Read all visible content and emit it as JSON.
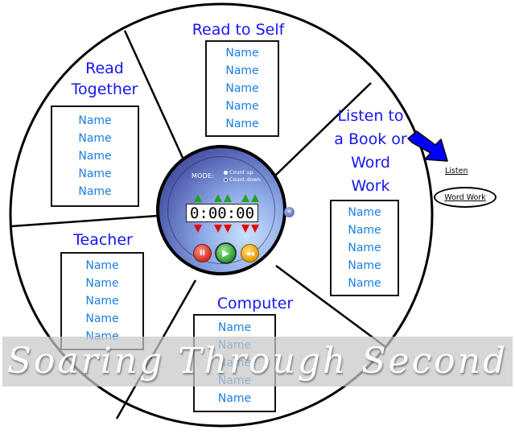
{
  "stations": {
    "read_to_self": {
      "title": "Read to Self",
      "names": [
        "Name",
        "Name",
        "Name",
        "Name",
        "Name"
      ]
    },
    "read_together": {
      "title_line1": "Read",
      "title_line2": "Together",
      "names": [
        "Name",
        "Name",
        "Name",
        "Name",
        "Name"
      ]
    },
    "listen_word_work": {
      "title_line1": "Listen to",
      "title_line2": "a Book or",
      "title_line3": "Word",
      "title_line4": "Work",
      "names": [
        "Name",
        "Name",
        "Name",
        "Name",
        "Name"
      ]
    },
    "teacher": {
      "title": "Teacher",
      "names": [
        "Name",
        "Name",
        "Name",
        "Name",
        "Name"
      ]
    },
    "computer": {
      "title": "Computer",
      "names": [
        "Name",
        "Name",
        "Name",
        "Name",
        "Name"
      ]
    }
  },
  "timer": {
    "mode_label": "MODE:",
    "mode_options": [
      {
        "label": "Count up",
        "selected": false
      },
      {
        "label": "Count down",
        "selected": true
      }
    ],
    "display": "0:00:00",
    "buttons": {
      "pause": "II",
      "play": "▶",
      "reset": "◀◀"
    },
    "collapse_glyph": "«"
  },
  "side_options": {
    "listen": "Listen",
    "word_work": "Word Work"
  },
  "watermark": "Soaring Through Second",
  "colors": {
    "title_blue": "#1616f0",
    "name_blue": "#1a7ee0",
    "arrow_blue": "#0000ff",
    "timer_face": "#4b57a8"
  }
}
